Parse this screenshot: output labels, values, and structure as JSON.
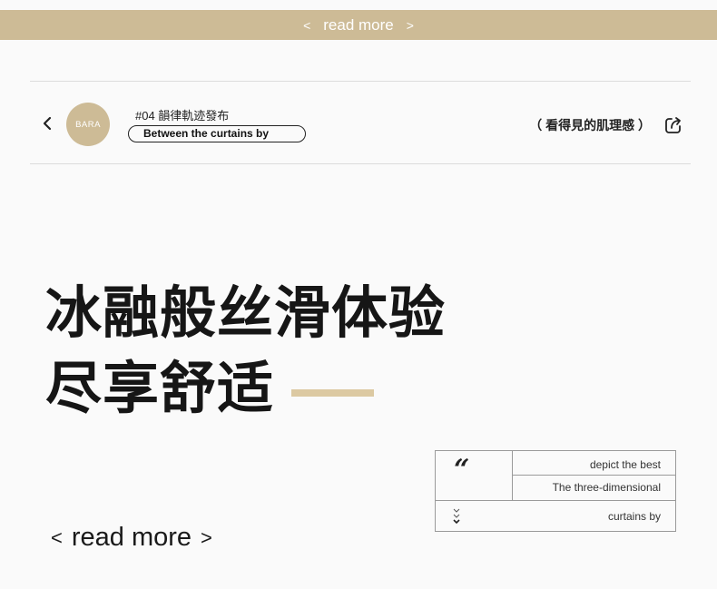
{
  "banner": {
    "prev": "<",
    "label": "read more",
    "next": ">"
  },
  "header": {
    "avatar_text": "BARA",
    "issue_title": "#04 韻律軌迹發布",
    "pill_text": "Between the curtains by",
    "right_label": "（ 看得見的肌理感 ）"
  },
  "hero": {
    "line1": "冰融般丝滑体验",
    "line2": "尽享舒适"
  },
  "info_table": {
    "quote": "“",
    "row1": "depict the best",
    "row2": "The three-dimensional",
    "row3": "curtains by"
  },
  "footer_link": {
    "prev": "<",
    "label": "read more",
    "next": ">"
  },
  "colors": {
    "accent": "#cdbb96",
    "accent_bar": "#dcc9a2"
  }
}
